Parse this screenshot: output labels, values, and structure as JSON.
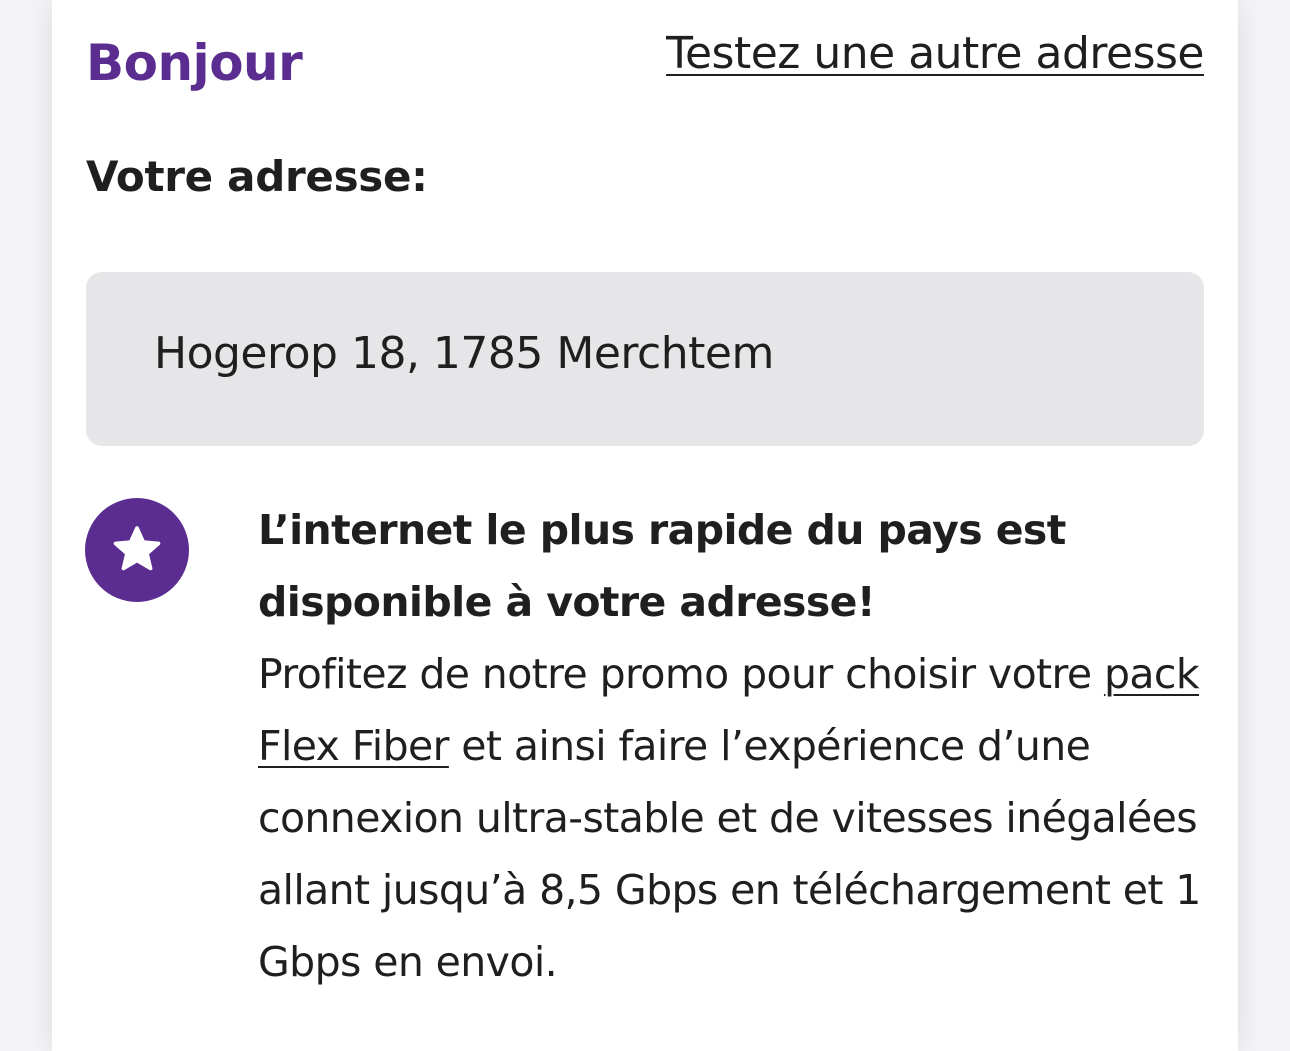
{
  "header": {
    "greeting": "Bonjour",
    "other_address_link": "Testez une autre adresse"
  },
  "address": {
    "label": "Votre adresse:",
    "value": "Hogerop 18, 1785 Merchtem"
  },
  "availability": {
    "icon": "star-icon",
    "headline": "L’internet le plus rapide du pays est disponible à votre adresse!",
    "body_before_link": "Profitez de notre promo pour choisir votre ",
    "link_text": "pack Flex Fiber",
    "body_after_link": " et ainsi faire l’expérience d’une connexion ultra-stable et de vitesses inégalées allant jusqu’à 8,5 Gbps en téléchargement et 1 Gbps en envoi."
  },
  "colors": {
    "brand_purple": "#5c2d91",
    "address_box_bg": "#e6e6e8",
    "text": "#1f1f1f"
  }
}
